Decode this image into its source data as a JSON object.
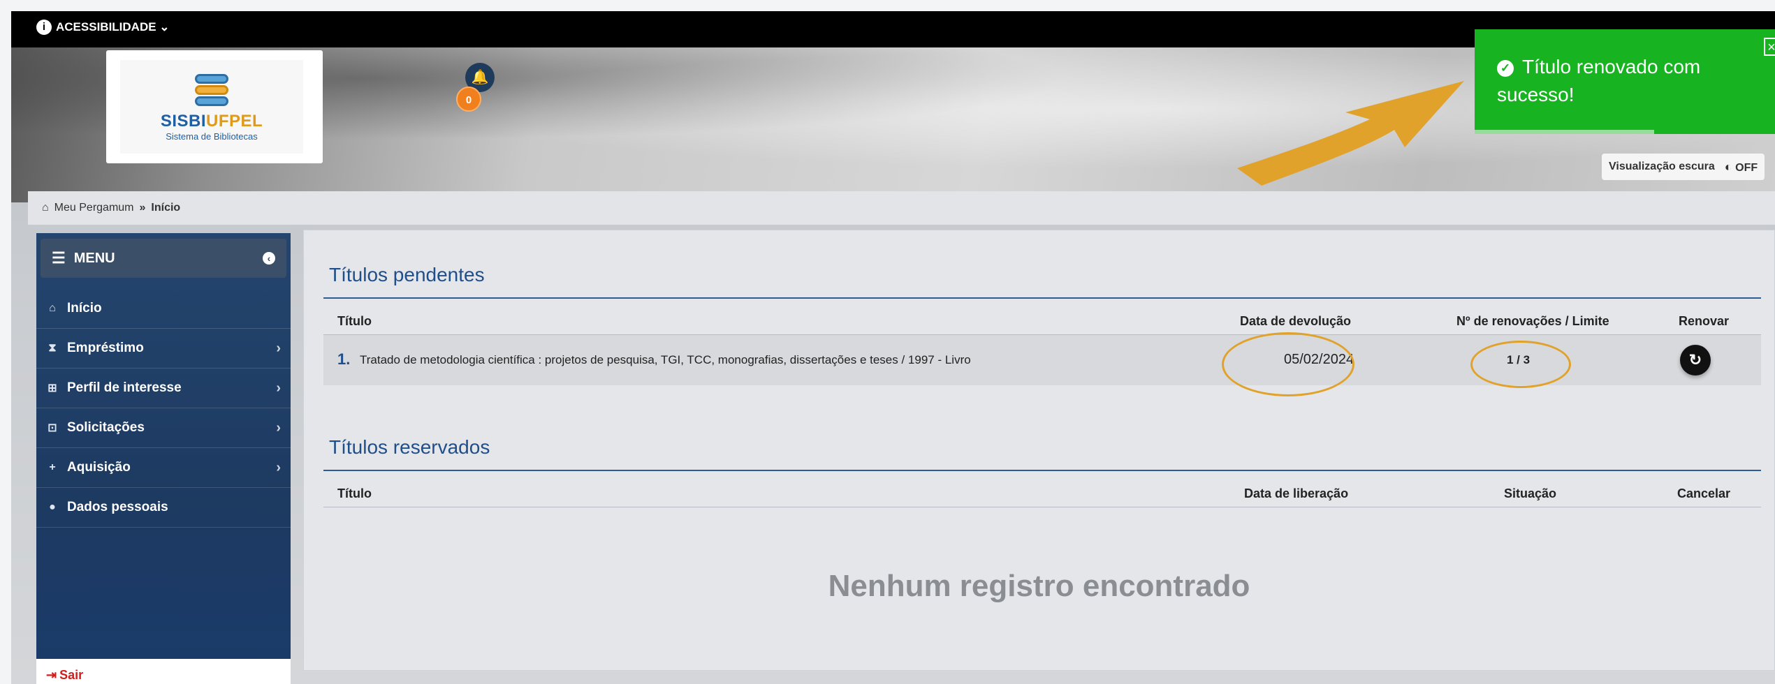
{
  "accessibility": {
    "label": "ACESSIBILIDADE ⌄"
  },
  "logo": {
    "brand_part1": "SISBI",
    "brand_part2": "UFPEL",
    "subtitle": "Sistema de Bibliotecas"
  },
  "notifications": {
    "count": "0"
  },
  "toast": {
    "message": "Título renovado com sucesso!",
    "close": "×",
    "type": "success"
  },
  "dark_mode": {
    "label": "Visualização escura",
    "state": "OFF"
  },
  "breadcrumb": {
    "home": "Meu Pergamum",
    "separator": "»",
    "current": "Início"
  },
  "menu": {
    "title": "MENU",
    "items": [
      {
        "label": "Início",
        "icon": "home-icon",
        "has_submenu": false
      },
      {
        "label": "Empréstimo",
        "icon": "hourglass-icon",
        "has_submenu": true
      },
      {
        "label": "Perfil de interesse",
        "icon": "sitemap-icon",
        "has_submenu": true
      },
      {
        "label": "Solicitações",
        "icon": "cart-icon",
        "has_submenu": true
      },
      {
        "label": "Aquisição",
        "icon": "plus-icon",
        "has_submenu": true
      },
      {
        "label": "Dados pessoais",
        "icon": "user-icon",
        "has_submenu": false
      }
    ],
    "logout": "Sair"
  },
  "pending": {
    "title": "Títulos pendentes",
    "columns": [
      "Título",
      "Data de devolução",
      "Nº de renovações / Limite",
      "Renovar"
    ],
    "rows": [
      {
        "num": "1.",
        "title": "Tratado de metodologia científica : projetos de pesquisa, TGI, TCC, monografias, dissertações e teses / 1997 - Livro",
        "due": "05/02/2024",
        "renewals": "1 / 3"
      }
    ]
  },
  "reserved": {
    "title": "Títulos reservados",
    "columns": [
      "Título",
      "Data de liberação",
      "Situação",
      "Cancelar"
    ],
    "empty": "Nenhum registro encontrado"
  },
  "colors": {
    "toast": "#17b320",
    "accent": "#1f4f8a",
    "annotation": "#e1a22c",
    "sidebar": "#1d3a61"
  }
}
